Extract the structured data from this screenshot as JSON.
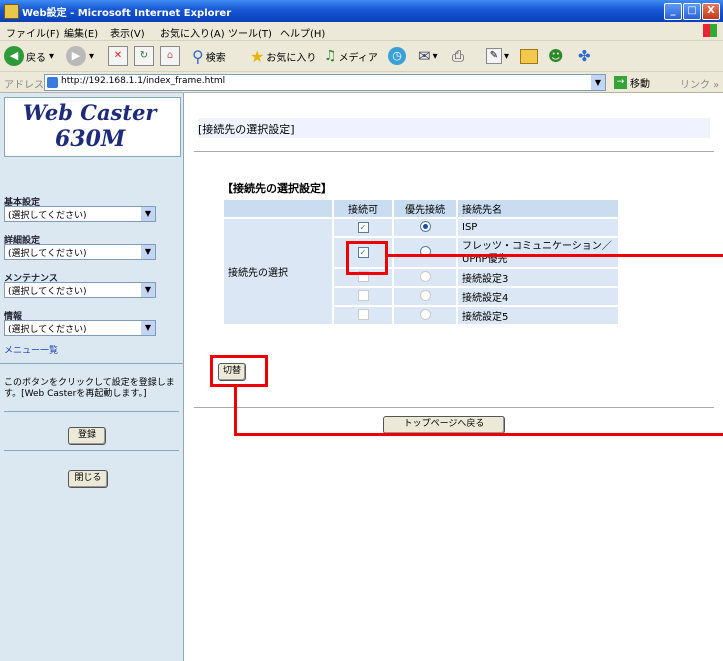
{
  "window": {
    "title": "Web設定 - Microsoft Internet Explorer",
    "minimize": "_",
    "maximize": "□",
    "close": "X"
  },
  "menubar": [
    "ファイル(F)",
    "編集(E)",
    "表示(V)",
    "お気に入り(A)",
    "ツール(T)",
    "ヘルプ(H)"
  ],
  "toolbar": {
    "back": "戻る",
    "search": "検索",
    "favorites": "お気に入り",
    "media": "メディア"
  },
  "address": {
    "label": "アドレス(D)",
    "value": "http://192.168.1.1/index_frame.html",
    "go": "移動",
    "links": "リンク »"
  },
  "sidebar": {
    "logo_line1": "Web Caster",
    "logo_line2": "630M",
    "sections": [
      {
        "label": "基本設定",
        "value": "(選択してください)"
      },
      {
        "label": "詳細設定",
        "value": "(選択してください)"
      },
      {
        "label": "メンテナンス",
        "value": "(選択してください)"
      },
      {
        "label": "情報",
        "value": "(選択してください)"
      }
    ],
    "menu_link": "メニュー一覧",
    "info_text": "このボタンをクリックして設定を登録します。[Web Casterを再起動します。]",
    "register_button": "登録",
    "close_button": "閉じる"
  },
  "main": {
    "header": "[接続先の選択設定]",
    "section_title": "【接続先の選択設定】",
    "columns": [
      "接続可",
      "優先接続",
      "接続先名"
    ],
    "row_label": "接続先の選択",
    "rows": [
      {
        "name": "ISP",
        "enabled": true,
        "priority": true,
        "disabled": false
      },
      {
        "name": "フレッツ・コミュニケーション／UPnP優先",
        "enabled": true,
        "priority": false,
        "disabled": false
      },
      {
        "name": "接続設定3",
        "enabled": false,
        "priority": false,
        "disabled": true
      },
      {
        "name": "接続設定4",
        "enabled": false,
        "priority": false,
        "disabled": true
      },
      {
        "name": "接続設定5",
        "enabled": false,
        "priority": false,
        "disabled": true
      }
    ],
    "switch_button": "切替",
    "top_button": "トップページへ戻る"
  },
  "accents": {
    "highlight": "#e00000",
    "table_bg": "#dbe7f4",
    "titlebar": "#1656d6"
  }
}
